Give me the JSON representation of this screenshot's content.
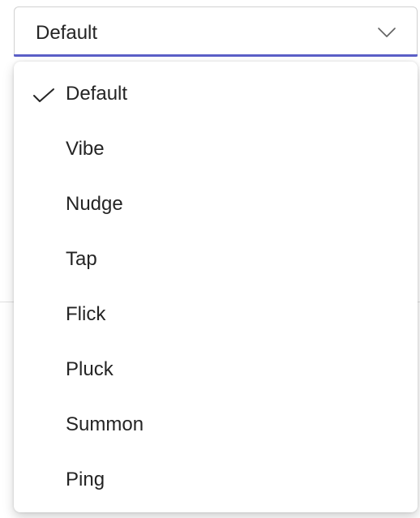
{
  "select": {
    "value": "Default",
    "accent_color": "#5b5fc7",
    "icon": "chevron-down-icon"
  },
  "listbox": {
    "selected_index": 0,
    "check_icon": "checkmark-icon",
    "options": [
      {
        "label": "Default",
        "selected": true
      },
      {
        "label": "Vibe",
        "selected": false
      },
      {
        "label": "Nudge",
        "selected": false
      },
      {
        "label": "Tap",
        "selected": false
      },
      {
        "label": "Flick",
        "selected": false
      },
      {
        "label": "Pluck",
        "selected": false
      },
      {
        "label": "Summon",
        "selected": false
      },
      {
        "label": "Ping",
        "selected": false
      }
    ]
  }
}
